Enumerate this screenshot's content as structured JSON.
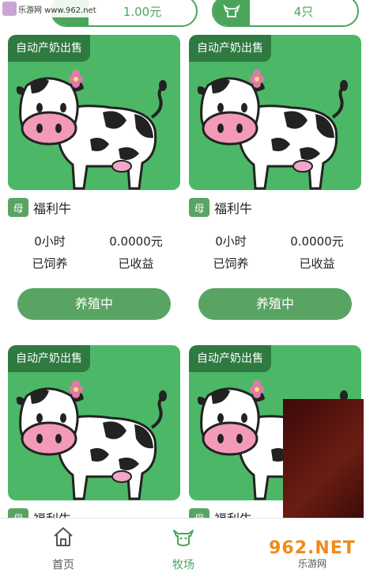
{
  "watermark": {
    "site": "乐游网 www.962.net",
    "brand": "962.NET",
    "brand_sub": "乐游网"
  },
  "top": {
    "price": {
      "icon": "plus-icon",
      "text": "1.00元"
    },
    "count": {
      "icon": "cow-icon",
      "text": "4只"
    }
  },
  "cards": [
    {
      "badge": "自动产奶出售",
      "tag": "母",
      "name": "福利牛",
      "hours": "0小时",
      "hours_label": "已饲养",
      "income": "0.0000元",
      "income_label": "已收益",
      "button": "养殖中"
    },
    {
      "badge": "自动产奶出售",
      "tag": "母",
      "name": "福利牛",
      "hours": "0小时",
      "hours_label": "已饲养",
      "income": "0.0000元",
      "income_label": "已收益",
      "button": "养殖中"
    },
    {
      "badge": "自动产奶出售",
      "tag": "母",
      "name": "福利牛"
    },
    {
      "badge": "自动产奶出售",
      "tag": "母",
      "name": "福利牛"
    }
  ],
  "tabs": [
    {
      "label": "首页",
      "icon": "home-icon"
    },
    {
      "label": "牧场",
      "icon": "cow-face-icon"
    }
  ],
  "colors": {
    "accent": "#4aa55a",
    "card_bg": "#4cb867",
    "badge_bg": "#2f7a40"
  }
}
